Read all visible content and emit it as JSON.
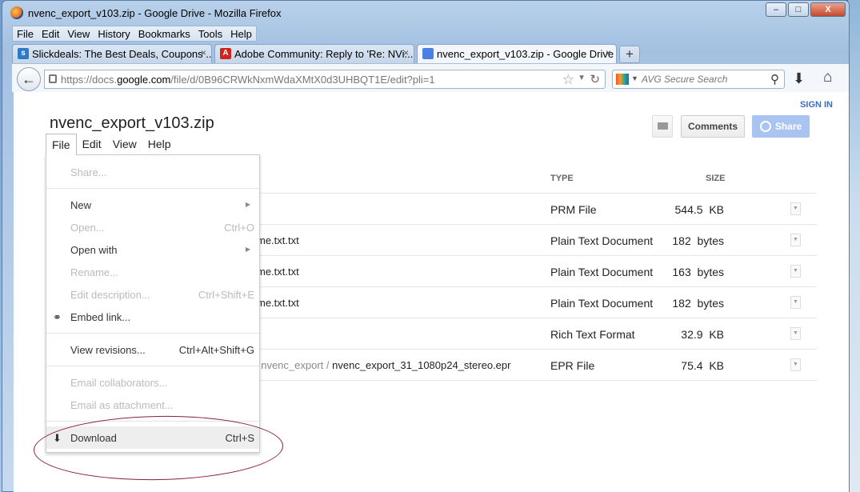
{
  "window": {
    "title": "nvenc_export_v103.zip - Google Drive - Mozilla Firefox",
    "controls": [
      "–",
      "□",
      "X"
    ]
  },
  "menubar": [
    "File",
    "Edit",
    "View",
    "History",
    "Bookmarks",
    "Tools",
    "Help"
  ],
  "tabs": [
    {
      "label": "Slickdeals: The Best Deals, Coupons ...",
      "close": "×",
      "icon": "slickdeals-icon",
      "icon_color": "#2b7bc9"
    },
    {
      "label": "Adobe Community: Reply to 'Re: NVi...",
      "close": "×",
      "icon": "adobe-icon",
      "icon_color": "#d2231b"
    },
    {
      "label": "nvenc_export_v103.zip - Google Drive",
      "close": "×",
      "icon": "google-docs-icon",
      "icon_color": "#4a7fe3"
    }
  ],
  "newtab": "+",
  "navbar": {
    "url_prefix": "https://docs.",
    "url_domain": "google.com",
    "url_rest": "/file/d/0B96CRWkNxmWdaXMtX0d3UHBQT1E/edit?pli=1",
    "search_placeholder": "AVG Secure Search"
  },
  "page": {
    "sign_in": "SIGN IN",
    "doc_title": "nvenc_export_v103.zip",
    "doc_menu": [
      "File",
      "Edit",
      "View",
      "Help"
    ],
    "comments_label": "Comments",
    "share_label": "Share"
  },
  "table": {
    "headers": {
      "type": "TYPE",
      "size": "SIZE"
    },
    "rows": [
      {
        "name": "",
        "path": "",
        "type": "PRM File",
        "size": "544.5  KB"
      },
      {
        "name": "me.txt.txt",
        "path": "",
        "type": "Plain Text Document",
        "size": "182  bytes"
      },
      {
        "name": "me.txt.txt",
        "path": "",
        "type": "Plain Text Document",
        "size": "163  bytes"
      },
      {
        "name": "me.txt.txt",
        "path": "",
        "type": "Plain Text Document",
        "size": "182  bytes"
      },
      {
        "name": "",
        "path": "",
        "type": "Rich Text Format",
        "size": "32.9  KB"
      },
      {
        "name": "nvenc_export_31_1080p24_stereo.epr",
        "path": "/  nvenc_export  /",
        "type": "EPR File",
        "size": "75.4  KB"
      }
    ]
  },
  "file_menu": {
    "items": [
      {
        "label": "Share...",
        "shortcut": "",
        "enabled": false
      },
      {
        "label": "New",
        "shortcut": "",
        "enabled": true,
        "submenu": true
      },
      {
        "label": "Open...",
        "shortcut": "Ctrl+O",
        "enabled": false
      },
      {
        "label": "Open with",
        "shortcut": "",
        "enabled": true,
        "submenu": true
      },
      {
        "label": "Rename...",
        "shortcut": "",
        "enabled": false
      },
      {
        "label": "Edit description...",
        "shortcut": "Ctrl+Shift+E",
        "enabled": false
      },
      {
        "label": "Embed link...",
        "shortcut": "",
        "enabled": true,
        "icon": "link-icon"
      },
      {
        "label": "View revisions...",
        "shortcut": "Ctrl+Alt+Shift+G",
        "enabled": true
      },
      {
        "label": "Email collaborators...",
        "shortcut": "",
        "enabled": false
      },
      {
        "label": "Email as attachment...",
        "shortcut": "",
        "enabled": false
      },
      {
        "label": "Download",
        "shortcut": "Ctrl+S",
        "enabled": true,
        "icon": "download-icon"
      }
    ]
  }
}
